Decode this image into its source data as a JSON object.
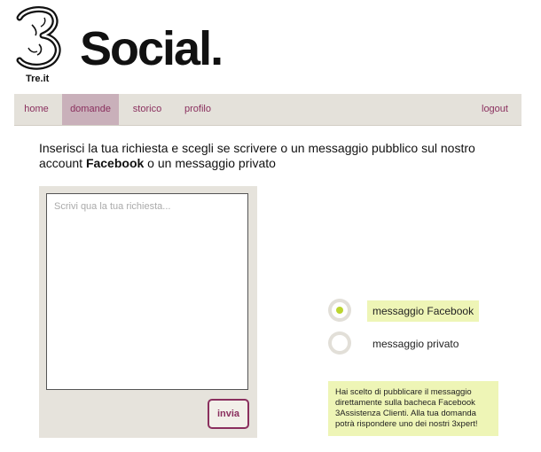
{
  "brand": {
    "name": "Social.",
    "logo_caption": "Tre.it",
    "logo_icon": "three-logo-icon"
  },
  "nav": {
    "items": [
      {
        "label": "home",
        "active": false
      },
      {
        "label": "domande",
        "active": true
      },
      {
        "label": "storico",
        "active": false
      },
      {
        "label": "profilo",
        "active": false
      }
    ],
    "logout_label": "logout"
  },
  "intro": {
    "before": "Inserisci la tua richiesta e scegli se scrivere o un messaggio pubblico sul nostro account ",
    "emphasis": "Facebook",
    "after": " o un messaggio privato"
  },
  "compose": {
    "placeholder": "Scrivi qua la tua richiesta...",
    "value": "",
    "send_label": "invia"
  },
  "message_type": {
    "options": [
      {
        "label": "messaggio Facebook",
        "selected": true
      },
      {
        "label": "messaggio privato",
        "selected": false
      }
    ],
    "info": "Hai scelto di pubblicare il messaggio direttamente sulla bacheca Facebook 3Assistenza Clienti. Alla tua domanda potrà rispondere uno dei nostri 3xpert!"
  },
  "colors": {
    "accent": "#8a2f5e",
    "nav_background": "#e4e1da",
    "nav_active": "#c9b0ba",
    "highlight": "#eef5b6",
    "radio_dot": "#bcd530"
  }
}
